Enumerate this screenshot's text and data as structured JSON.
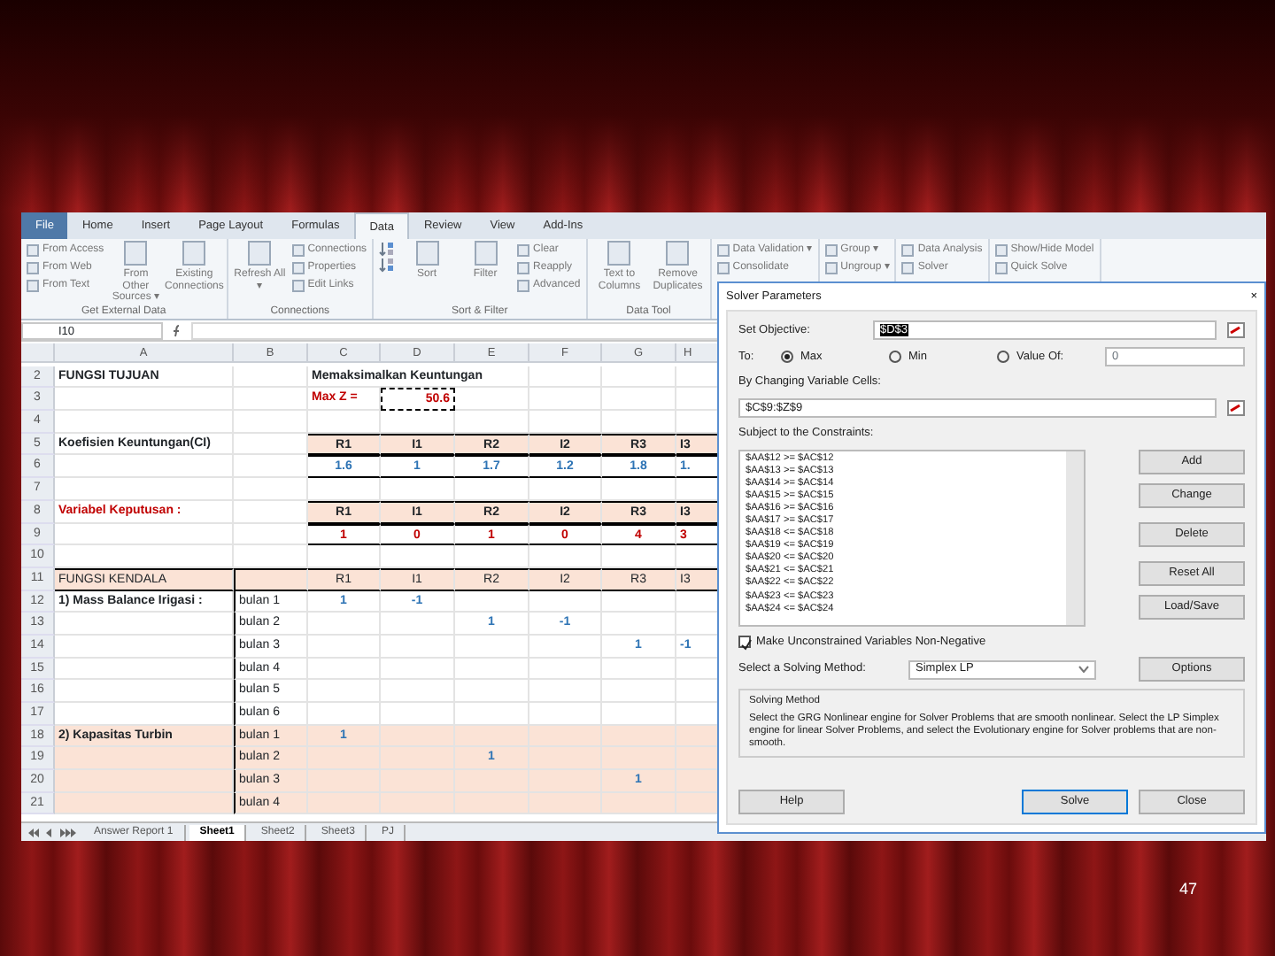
{
  "ribbon": {
    "tabs": [
      {
        "label": "File",
        "selected": false,
        "kind": "file"
      },
      {
        "label": "Home",
        "selected": false,
        "kind": "tab"
      },
      {
        "label": "Insert",
        "selected": false,
        "kind": "tab"
      },
      {
        "label": "Page Layout",
        "selected": false,
        "kind": "tab"
      },
      {
        "label": "Formulas",
        "selected": false,
        "kind": "tab"
      },
      {
        "label": "Data",
        "selected": true,
        "kind": "tab"
      },
      {
        "label": "Review",
        "selected": false,
        "kind": "tab"
      },
      {
        "label": "View",
        "selected": false,
        "kind": "tab"
      },
      {
        "label": "Add-Ins",
        "selected": false,
        "kind": "tab"
      }
    ],
    "groups": [
      {
        "label": "Get External Data",
        "items": [
          {
            "kind": "small",
            "label": "From Access"
          },
          {
            "kind": "small",
            "label": "From Web"
          },
          {
            "kind": "small",
            "label": "From Text"
          },
          {
            "kind": "large",
            "label": "From Other Sources ▾"
          },
          {
            "kind": "large",
            "label": "Existing Connections"
          }
        ]
      },
      {
        "label": "Connections",
        "items": [
          {
            "kind": "large",
            "label": "Refresh All ▾"
          },
          {
            "kind": "small",
            "label": "Connections"
          },
          {
            "kind": "small",
            "label": "Properties"
          },
          {
            "kind": "small",
            "label": "Edit Links"
          }
        ]
      },
      {
        "label": "Sort & Filter",
        "items": [
          {
            "kind": "sort_icons"
          },
          {
            "kind": "large",
            "label": "Sort"
          },
          {
            "kind": "large",
            "label": "Filter"
          },
          {
            "kind": "small",
            "label": "Clear"
          },
          {
            "kind": "small",
            "label": "Reapply"
          },
          {
            "kind": "small",
            "label": "Advanced"
          }
        ]
      },
      {
        "label": "Data Tool",
        "items": [
          {
            "kind": "large",
            "label": "Text to Columns"
          },
          {
            "kind": "large",
            "label": "Remove Duplicates"
          }
        ]
      },
      {
        "items": [
          {
            "kind": "small",
            "label": "Data Validation ▾"
          },
          {
            "kind": "small",
            "label": "Consolidate"
          }
        ]
      },
      {
        "items": [
          {
            "kind": "small",
            "label": "Group ▾"
          },
          {
            "kind": "small",
            "label": "Ungroup ▾"
          }
        ]
      },
      {
        "items": [
          {
            "kind": "small",
            "label": "Data Analysis"
          },
          {
            "kind": "small",
            "label": "Solver"
          }
        ]
      },
      {
        "items": [
          {
            "kind": "small",
            "label": "Show/Hide Model"
          },
          {
            "kind": "small",
            "label": "Quick Solve"
          }
        ]
      }
    ]
  },
  "name_box": "I10",
  "columns": [
    "A",
    "B",
    "C",
    "D",
    "E",
    "F",
    "G",
    "H"
  ],
  "rows": [
    {
      "num": "2",
      "kind": "title",
      "cells": {
        "A": "FUNGSI TUJUAN",
        "C": "Memaksimalkan Keuntungan"
      }
    },
    {
      "num": "3",
      "kind": "objective",
      "cells": {
        "C": "Max Z =",
        "D": "50.6"
      }
    },
    {
      "num": "4",
      "kind": "blank",
      "cells": {}
    },
    {
      "num": "5",
      "kind": "coef_header",
      "cells": {
        "A": "Koefisien Keuntungan(CI)",
        "C": "R1",
        "D": "I1",
        "E": "R2",
        "F": "I2",
        "G": "R3",
        "H": "I3"
      }
    },
    {
      "num": "6",
      "kind": "coef",
      "cells": {
        "C": "1.6",
        "D": "1",
        "E": "1.7",
        "F": "1.2",
        "G": "1.8",
        "H": "1."
      }
    },
    {
      "num": "7",
      "kind": "blank",
      "cells": {}
    },
    {
      "num": "8",
      "kind": "decision_header",
      "cells": {
        "A": "Variabel Keputusan :",
        "C": "R1",
        "D": "I1",
        "E": "R2",
        "F": "I2",
        "G": "R3",
        "H": "I3"
      }
    },
    {
      "num": "9",
      "kind": "decision",
      "cells": {
        "C": "1",
        "D": "0",
        "E": "1",
        "F": "0",
        "G": "4",
        "H": "3"
      }
    },
    {
      "num": "10",
      "kind": "blank",
      "cells": {}
    },
    {
      "num": "11",
      "kind": "constraint_header",
      "cells": {
        "A": "FUNGSI KENDALA",
        "C": "R1",
        "D": "I1",
        "E": "R2",
        "F": "I2",
        "G": "R3",
        "H": "I3"
      }
    },
    {
      "num": "12",
      "kind": "constraint",
      "cells": {
        "A": "1) Mass Balance Irigasi :",
        "B": "bulan 1",
        "C": "1",
        "D": "-1"
      }
    },
    {
      "num": "13",
      "kind": "constraint",
      "cells": {
        "B": "bulan 2",
        "E": "1",
        "F": "-1"
      }
    },
    {
      "num": "14",
      "kind": "constraint",
      "cells": {
        "B": "bulan 3",
        "G": "1",
        "H": "-1"
      }
    },
    {
      "num": "15",
      "kind": "constraint",
      "cells": {
        "B": "bulan 4"
      }
    },
    {
      "num": "16",
      "kind": "constraint",
      "cells": {
        "B": "bulan 5"
      }
    },
    {
      "num": "17",
      "kind": "constraint",
      "cells": {
        "B": "bulan 6"
      }
    },
    {
      "num": "18",
      "kind": "constraint_alt",
      "cells": {
        "A": "2) Kapasitas Turbin",
        "B": "bulan 1",
        "C": "1"
      }
    },
    {
      "num": "19",
      "kind": "constraint_alt",
      "cells": {
        "B": "bulan 2",
        "E": "1"
      }
    },
    {
      "num": "20",
      "kind": "constraint_alt",
      "cells": {
        "B": "bulan 3",
        "G": "1"
      }
    },
    {
      "num": "21",
      "kind": "constraint_alt",
      "cells": {
        "B": "bulan 4"
      }
    }
  ],
  "sheet_tabs": [
    {
      "label": "Answer Report 1",
      "selected": false
    },
    {
      "label": "Sheet1",
      "selected": true
    },
    {
      "label": "Sheet2",
      "selected": false
    },
    {
      "label": "Sheet3",
      "selected": false
    },
    {
      "label": "PJ",
      "selected": false
    }
  ],
  "solver": {
    "title": "Solver Parameters",
    "close": "×",
    "objective_label": "Set Objective:",
    "objective": "$D$3",
    "to_label": "To:",
    "targets": [
      {
        "label": "Max",
        "selected": true
      },
      {
        "label": "Min",
        "selected": false
      },
      {
        "label": "Value Of:",
        "selected": false
      }
    ],
    "value_of": "0",
    "changing_label": "By Changing Variable Cells:",
    "changing": "$C$9:$Z$9",
    "constraints_label": "Subject to the Constraints:",
    "constraints": [
      "$AA$12 >= $AC$12",
      "$AA$13 >= $AC$13",
      "$AA$14 >= $AC$14",
      "$AA$15 >= $AC$15",
      "$AA$16 >= $AC$16",
      "$AA$17 >= $AC$17",
      "$AA$18 <= $AC$18",
      "$AA$19 <= $AC$19",
      "$AA$20 <= $AC$20",
      "$AA$21 <= $AC$21",
      "$AA$22 <= $AC$22",
      "$AA$23 <= $AC$23",
      "$AA$24 <= $AC$24"
    ],
    "side_buttons": [
      "Add",
      "Change",
      "Delete",
      "Reset All",
      "Load/Save"
    ],
    "nonneg": {
      "label": "Make Unconstrained Variables Non-Negative",
      "checked": true
    },
    "method_label": "Select a Solving Method:",
    "method": "Simplex LP",
    "options": "Options",
    "method_group": "Solving Method",
    "method_text": "Select the GRG Nonlinear engine for Solver Problems that are smooth nonlinear. Select the LP Simplex engine for linear Solver Problems, and select the Evolutionary engine for Solver problems that are non-smooth.",
    "buttons": [
      "Help",
      "Solve",
      "Close"
    ]
  },
  "page_number": "47"
}
